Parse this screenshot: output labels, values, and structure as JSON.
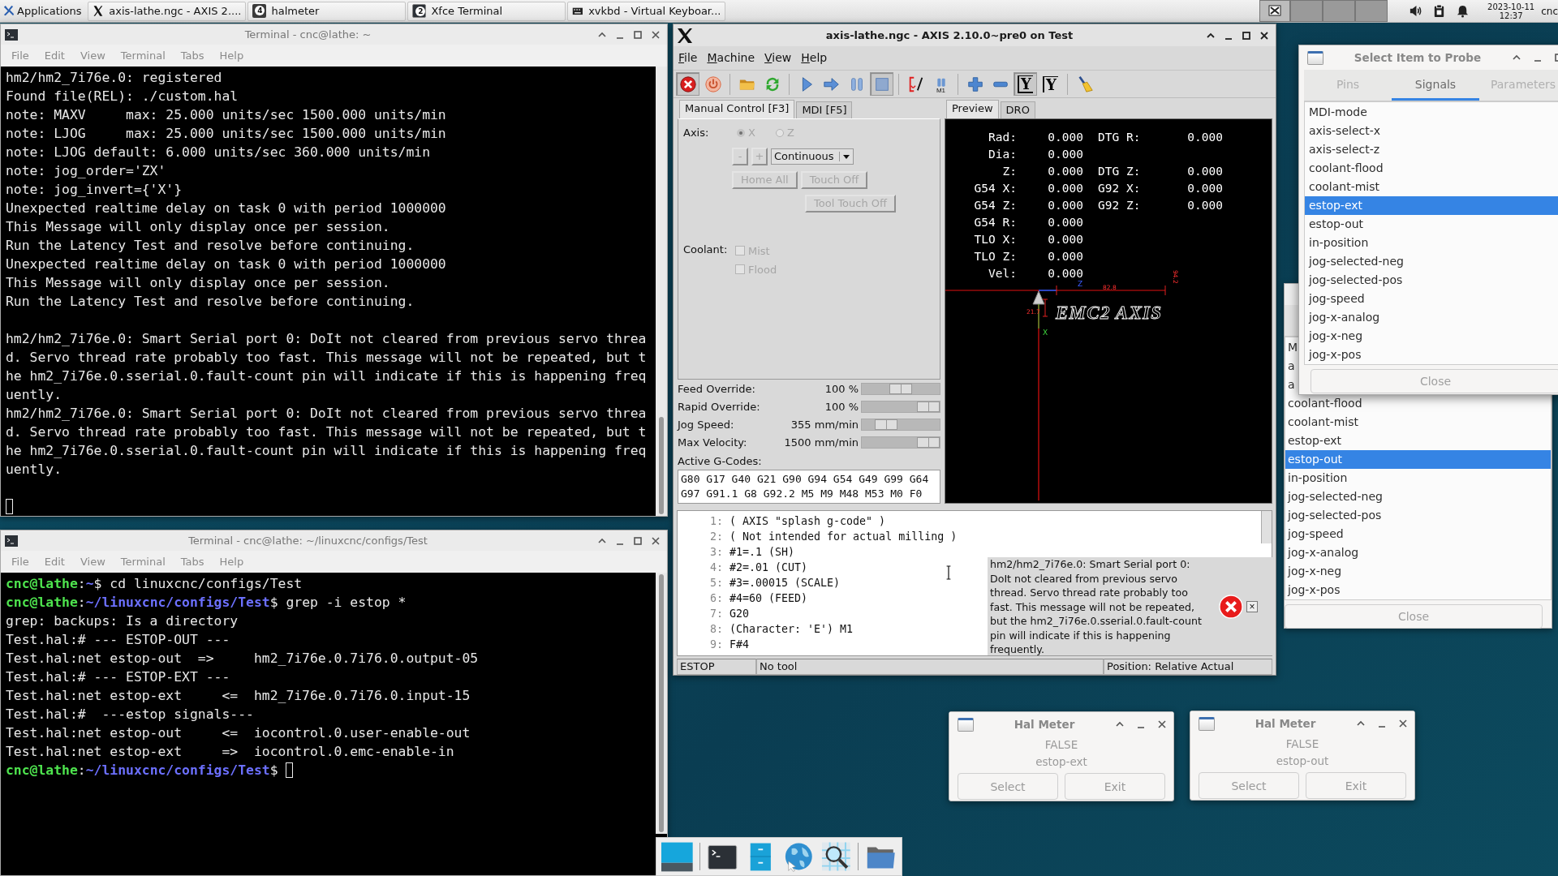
{
  "top_panel": {
    "applications": "Applications",
    "tasks": [
      {
        "kind": "x-logo",
        "title": "axis-lathe.ngc - AXIS 2...."
      },
      {
        "kind": "halmeter",
        "title": "halmeter",
        "count": "4"
      },
      {
        "kind": "terminal",
        "title": "Xfce Terminal",
        "count": "2"
      },
      {
        "kind": "keyboard",
        "title": "xvkbd - Virtual Keyboar..."
      }
    ],
    "date": "2023-10-11",
    "time": "12:37",
    "user": "cnc"
  },
  "terminals": [
    {
      "title": "Terminal - cnc@lathe: ~",
      "menu": [
        "File",
        "Edit",
        "View",
        "Terminal",
        "Tabs",
        "Help"
      ],
      "blocks": [
        [
          {
            "kind": "output",
            "text": "hm2/hm2_7i76e.0: registered"
          },
          {
            "kind": "output",
            "text": "Found file(REL): ./custom.hal"
          },
          {
            "kind": "output",
            "text": "note: MAXV     max: 25.000 units/sec 1500.000 units/min"
          },
          {
            "kind": "output",
            "text": "note: LJOG     max: 25.000 units/sec 1500.000 units/min"
          },
          {
            "kind": "output",
            "text": "note: LJOG default: 6.000 units/sec 360.000 units/min"
          },
          {
            "kind": "output",
            "text": "note: jog_order='ZX'"
          },
          {
            "kind": "output",
            "text": "note: jog_invert={'X'}"
          },
          {
            "kind": "output",
            "text": "Unexpected realtime delay on task 0 with period 1000000"
          },
          {
            "kind": "output",
            "text": "This Message will only display once per session."
          },
          {
            "kind": "output",
            "text": "Run the Latency Test and resolve before continuing."
          },
          {
            "kind": "output",
            "text": "Unexpected realtime delay on task 0 with period 1000000"
          },
          {
            "kind": "output",
            "text": "This Message will only display once per session."
          },
          {
            "kind": "output",
            "text": "Run the Latency Test and resolve before continuing."
          }
        ],
        [
          {
            "kind": "output",
            "text": "hm2/hm2_7i76e.0: Smart Serial port 0: DoIt not cleared from previous servo threa"
          },
          {
            "kind": "output",
            "text": "d. Servo thread rate probably too fast. This message will not be repeated, but t"
          },
          {
            "kind": "output",
            "text": "he hm2_7i76e.0.sserial.0.fault-count pin will indicate if this is happening freq"
          },
          {
            "kind": "output",
            "text": "uently."
          },
          {
            "kind": "output",
            "text": "hm2/hm2_7i76e.0: Smart Serial port 0: DoIt not cleared from previous servo threa"
          },
          {
            "kind": "output",
            "text": "d. Servo thread rate probably too fast. This message will not be repeated, but t"
          },
          {
            "kind": "output",
            "text": "he hm2_7i76e.0.sserial.0.fault-count pin will indicate if this is happening freq"
          },
          {
            "kind": "output",
            "text": "uently."
          }
        ],
        [
          {
            "kind": "cursor"
          }
        ]
      ]
    },
    {
      "title": "Terminal - cnc@lathe: ~/linuxcnc/configs/Test",
      "menu": [
        "File",
        "Edit",
        "View",
        "Terminal",
        "Tabs",
        "Help"
      ],
      "blocks": [
        [
          {
            "kind": "prompt",
            "user": "cnc@lathe",
            "sep": ":",
            "path": "~",
            "command": "$ cd linuxcnc/configs/Test"
          },
          {
            "kind": "prompt",
            "user": "cnc@lathe",
            "sep": ":",
            "path": "~/linuxcnc/configs/Test",
            "command": "$ grep -i estop *"
          },
          {
            "kind": "output",
            "text": "grep: backups: Is a directory"
          },
          {
            "kind": "output",
            "text": "Test.hal:# --- ESTOP-OUT ---"
          },
          {
            "kind": "output",
            "text": "Test.hal:net estop-out  =>     hm2_7i76e.0.7i76.0.output-05"
          },
          {
            "kind": "output",
            "text": "Test.hal:# --- ESTOP-EXT ---"
          },
          {
            "kind": "output",
            "text": "Test.hal:net estop-ext     <=  hm2_7i76e.0.7i76.0.input-15"
          },
          {
            "kind": "output",
            "text": "Test.hal:#  ---estop signals---"
          },
          {
            "kind": "output",
            "text": "Test.hal:net estop-out     <=  iocontrol.0.user-enable-out"
          },
          {
            "kind": "output",
            "text": "Test.hal:net estop-ext     =>  iocontrol.0.emc-enable-in"
          },
          {
            "kind": "prompt",
            "user": "cnc@lathe",
            "sep": ":",
            "path": "~/linuxcnc/configs/Test",
            "command": "$ ",
            "cursor": true
          }
        ]
      ]
    }
  ],
  "axis": {
    "title": "axis-lathe.ngc - AXIS 2.10.0~pre0 on Test",
    "menu": [
      "File",
      "Machine",
      "View",
      "Help"
    ],
    "toolbar": [
      [
        {
          "kind": "estop",
          "pressed": true
        },
        {
          "kind": "power",
          "pressed": false
        }
      ],
      [
        {
          "kind": "open",
          "pressed": false
        },
        {
          "kind": "reload",
          "pressed": false
        }
      ],
      [
        {
          "kind": "run",
          "pressed": false
        },
        {
          "kind": "step",
          "pressed": false
        },
        {
          "kind": "pause",
          "pressed": false
        },
        {
          "kind": "stop",
          "pressed": true
        }
      ],
      [
        {
          "kind": "skip",
          "pressed": false
        },
        {
          "kind": "optional-stop",
          "label": "M1",
          "pressed": false
        }
      ],
      [
        {
          "kind": "zoom-in",
          "pressed": false
        },
        {
          "kind": "zoom-out",
          "pressed": false
        },
        {
          "kind": "view",
          "label": "Y",
          "pressed": true
        },
        {
          "kind": "view-rotated",
          "label": "Y",
          "pressed": false
        }
      ],
      [
        {
          "kind": "clear",
          "pressed": false
        }
      ]
    ],
    "left_tabs": [
      {
        "label": "Manual Control [F3]",
        "selected": true
      },
      {
        "label": "MDI [F5]",
        "selected": false
      }
    ],
    "axis_label": "Axis:",
    "axes": [
      {
        "label": "X",
        "selected": true,
        "disabled": true
      },
      {
        "label": "Z",
        "selected": false,
        "disabled": true
      }
    ],
    "jog_buttons": [
      {
        "label": "-",
        "disabled": true
      },
      {
        "label": "+",
        "disabled": true
      }
    ],
    "jog_mode": "Continuous",
    "buttons": [
      {
        "label": "Home All",
        "disabled": true
      },
      {
        "label": "Touch Off",
        "disabled": true
      },
      {
        "label": "Tool Touch Off",
        "disabled": true
      }
    ],
    "coolant_label": "Coolant:",
    "coolant": [
      {
        "label": "Mist",
        "checked": false,
        "disabled": true
      },
      {
        "label": "Flood",
        "checked": false,
        "disabled": true
      }
    ],
    "sliders": [
      {
        "label": "Feed Override:",
        "reading": "100 %",
        "level": 0.5
      },
      {
        "label": "Rapid Override:",
        "reading": "100 %",
        "level": 1
      },
      {
        "label": "Jog Speed:",
        "reading": "355 mm/min",
        "level": 0.24
      },
      {
        "label": "Max Velocity:",
        "reading": "1500 mm/min",
        "level": 1
      }
    ],
    "gcodes_label": "Active G-Codes:",
    "gcodes": [
      "G80 G17 G40 G21 G90 G94 G54 G49 G99 G64",
      "G97 G91.1 G8 G92.2 M5 M9 M48 M53 M0 F0"
    ],
    "right_tabs": [
      {
        "label": "Preview",
        "selected": true
      },
      {
        "label": "DRO",
        "selected": false
      }
    ],
    "dro": [
      [
        "Rad:",
        "0.000",
        "DTG R:",
        "0.000"
      ],
      [
        "Dia:",
        "0.000"
      ],
      [
        "Z:",
        "0.000",
        "DTG Z:",
        "0.000"
      ],
      [
        "G54 X:",
        "0.000",
        "G92 X:",
        "0.000"
      ],
      [
        "G54 Z:",
        "0.000",
        "G92 Z:",
        "0.000"
      ],
      [
        "G54 R:",
        "0.000"
      ],
      [
        "TLO X:",
        "0.000"
      ],
      [
        "TLO Z:",
        "0.000"
      ],
      [
        "Vel:",
        "0.000"
      ]
    ],
    "preview": {
      "logo": "EMC2 AXIS",
      "dims": [
        "82.8",
        "94.2",
        "21.7"
      ],
      "axis_labels": [
        "Z",
        "X"
      ]
    },
    "code": [
      {
        "num": "1:",
        "text": "( AXIS \"splash g-code\" )"
      },
      {
        "num": "2:",
        "text": "( Not intended for actual milling )"
      },
      {
        "num": "3:",
        "text": "#1=.1 (SH)"
      },
      {
        "num": "4:",
        "text": "#2=.01 (CUT)"
      },
      {
        "num": "5:",
        "text": "#3=.00015 (SCALE)"
      },
      {
        "num": "6:",
        "text": "#4=60 (FEED)"
      },
      {
        "num": "7:",
        "text": "G20"
      },
      {
        "num": "8:",
        "text": "(Character: 'E') M1"
      },
      {
        "num": "9:",
        "text": "F#4"
      }
    ],
    "message": {
      "kind": "error",
      "text": "hm2/hm2_7i76e.0: Smart Serial port 0: DoIt not cleared from previous servo thread. Servo thread rate probably too fast. This message will not be repeated, but the hm2_7i76e.0.sserial.0.fault-count pin will indicate if this is happening frequently.",
      "close": "×"
    },
    "status": [
      "ESTOP",
      "No tool",
      "Position: Relative Actual"
    ]
  },
  "probe_back": {
    "items": [
      {
        "label": "M",
        "selected": false
      },
      {
        "label": "a",
        "selected": false
      },
      {
        "label": "a",
        "selected": false
      },
      {
        "label": "coolant-flood",
        "selected": false
      },
      {
        "label": "coolant-mist",
        "selected": false
      },
      {
        "label": "estop-ext",
        "selected": false
      },
      {
        "label": "estop-out",
        "selected": true
      },
      {
        "label": "in-position",
        "selected": false
      },
      {
        "label": "jog-selected-neg",
        "selected": false
      },
      {
        "label": "jog-selected-pos",
        "selected": false
      },
      {
        "label": "jog-speed",
        "selected": false
      },
      {
        "label": "jog-x-analog",
        "selected": false
      },
      {
        "label": "jog-x-neg",
        "selected": false
      },
      {
        "label": "jog-x-pos",
        "selected": false
      }
    ],
    "close": "Close"
  },
  "probe": {
    "title": "Select Item to Probe",
    "tabs": [
      {
        "label": "Pins",
        "selected": false
      },
      {
        "label": "Signals",
        "selected": true
      },
      {
        "label": "Parameters",
        "selected": false
      }
    ],
    "items": [
      {
        "label": "MDI-mode",
        "selected": false
      },
      {
        "label": "axis-select-x",
        "selected": false
      },
      {
        "label": "axis-select-z",
        "selected": false
      },
      {
        "label": "coolant-flood",
        "selected": false
      },
      {
        "label": "coolant-mist",
        "selected": false
      },
      {
        "label": "estop-ext",
        "selected": true
      },
      {
        "label": "estop-out",
        "selected": false
      },
      {
        "label": "in-position",
        "selected": false
      },
      {
        "label": "jog-selected-neg",
        "selected": false
      },
      {
        "label": "jog-selected-pos",
        "selected": false
      },
      {
        "label": "jog-speed",
        "selected": false
      },
      {
        "label": "jog-x-analog",
        "selected": false
      },
      {
        "label": "jog-x-neg",
        "selected": false
      },
      {
        "label": "jog-x-pos",
        "selected": false
      }
    ],
    "close": "Close"
  },
  "hal_meters": [
    {
      "title": "Hal Meter",
      "value": "FALSE",
      "signal": "estop-ext",
      "buttons": [
        "Select",
        "Exit"
      ]
    },
    {
      "title": "Hal Meter",
      "value": "FALSE",
      "signal": "estop-out",
      "buttons": [
        "Select",
        "Exit"
      ]
    }
  ]
}
